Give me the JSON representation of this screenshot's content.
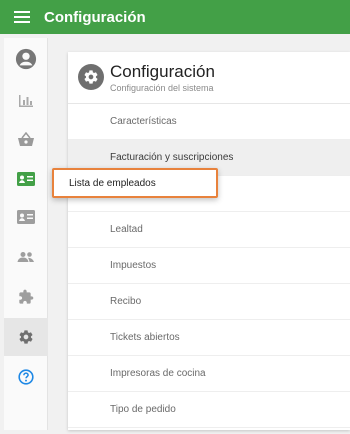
{
  "topbar": {
    "title": "Configuración",
    "menu_icon": "hamburger-menu-icon"
  },
  "sidebar": {
    "items": [
      {
        "icon": "account-circle-icon",
        "active": false
      },
      {
        "icon": "bar-chart-icon",
        "active": false
      },
      {
        "icon": "shopping-basket-icon",
        "active": false
      },
      {
        "icon": "employee-badge-icon",
        "active": false
      },
      {
        "icon": "customer-card-icon",
        "active": false
      },
      {
        "icon": "people-icon",
        "active": false
      },
      {
        "icon": "puzzle-piece-icon",
        "active": false
      },
      {
        "icon": "gear-icon",
        "active": true
      },
      {
        "icon": "help-circle-icon",
        "active": false
      }
    ]
  },
  "main": {
    "title": "Configuración",
    "subtitle": "Configuración del sistema",
    "rows": [
      "Características",
      "Facturación y suscripciones",
      "",
      "Lealtad",
      "Impuestos",
      "Recibo",
      "Tickets abiertos",
      "Impresoras de cocina",
      "Tipo de pedido"
    ]
  },
  "tooltip": {
    "label": "Lista de empleados"
  },
  "colors": {
    "topbar": "#43a047",
    "accent_green": "#43a047",
    "help_blue": "#1e88e5",
    "tooltip_border": "#e8823c",
    "icon_gray": "#9e9e9e"
  }
}
